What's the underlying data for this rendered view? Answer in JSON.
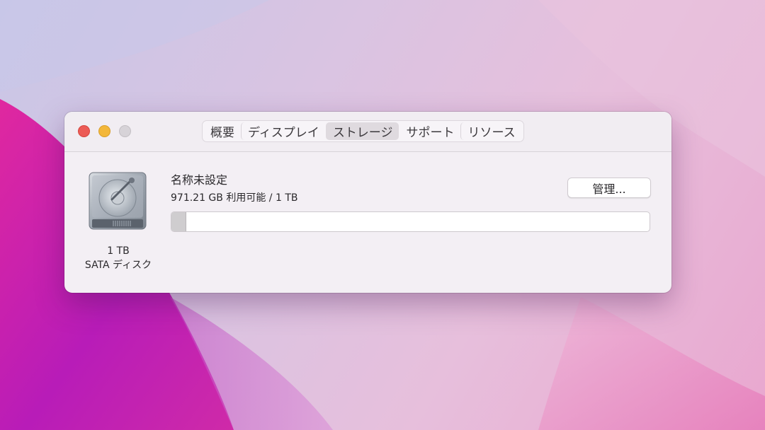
{
  "window": {
    "tabs": [
      {
        "label": "概要",
        "active": false
      },
      {
        "label": "ディスプレイ",
        "active": false
      },
      {
        "label": "ストレージ",
        "active": true
      },
      {
        "label": "サポート",
        "active": false
      },
      {
        "label": "リソース",
        "active": false
      }
    ]
  },
  "storage": {
    "disk_capacity": "1 TB",
    "disk_type": "SATA ディスク",
    "volume_name": "名称未設定",
    "volume_info": "971.21 GB 利用可能 / 1 TB",
    "manage_label": "管理...",
    "used_fraction": 0.029
  },
  "colors": {
    "close": "#ec5b56",
    "minimize": "#f3b73a",
    "zoom": "#d7d3d8",
    "wallpaper_accent": "#c21fb4"
  },
  "icons": {
    "disk": "hard-drive-icon"
  }
}
